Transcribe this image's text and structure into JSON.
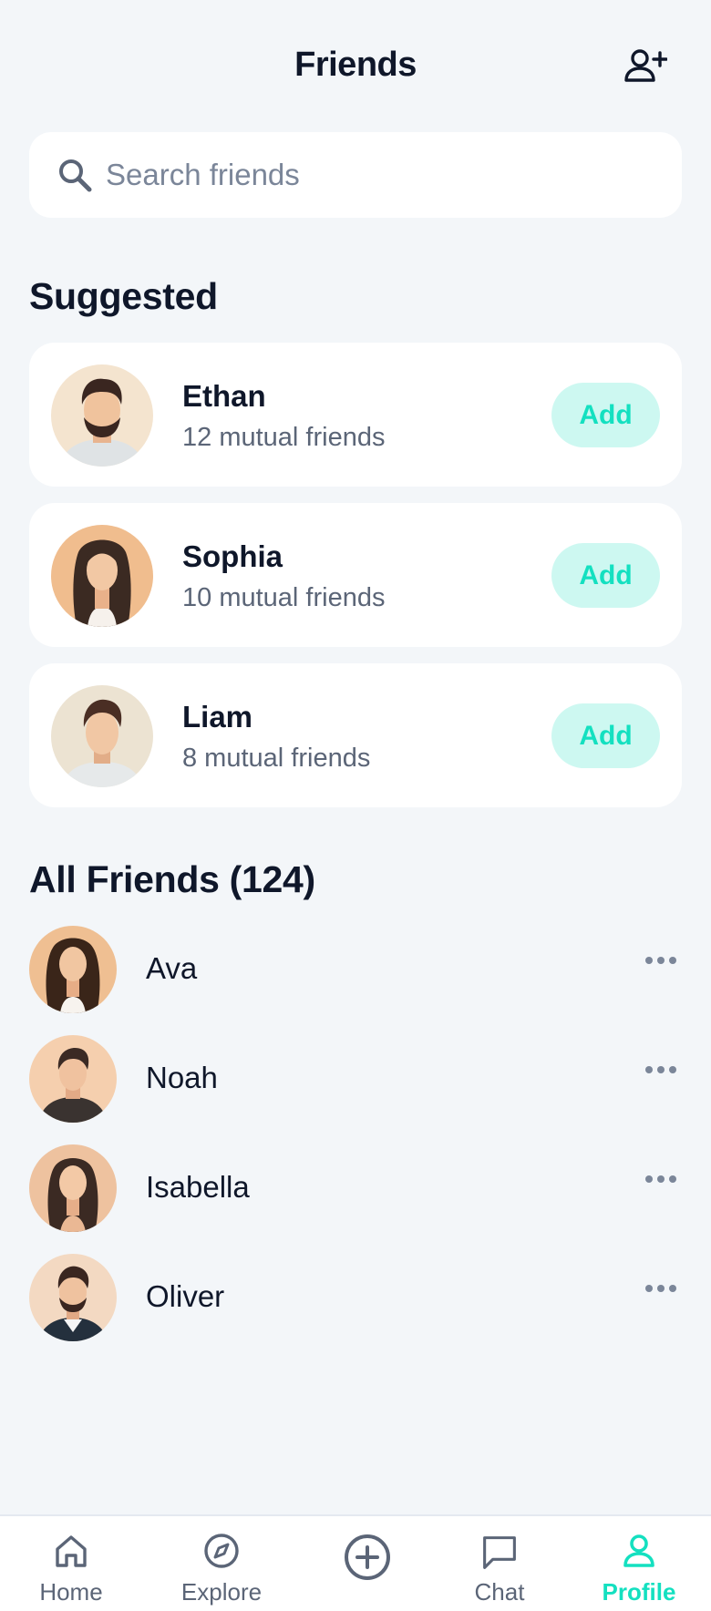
{
  "header": {
    "title": "Friends"
  },
  "search": {
    "placeholder": "Search friends",
    "value": ""
  },
  "suggested": {
    "title": "Suggested",
    "items": [
      {
        "name": "Ethan",
        "mutual": "12 mutual friends",
        "action": "Add"
      },
      {
        "name": "Sophia",
        "mutual": "10 mutual friends",
        "action": "Add"
      },
      {
        "name": "Liam",
        "mutual": "8 mutual friends",
        "action": "Add"
      }
    ]
  },
  "all_friends": {
    "title": "All Friends (124)",
    "items": [
      {
        "name": "Ava"
      },
      {
        "name": "Noah"
      },
      {
        "name": "Isabella"
      },
      {
        "name": "Oliver"
      }
    ]
  },
  "nav": {
    "items": [
      {
        "label": "Home",
        "icon": "home-icon"
      },
      {
        "label": "Explore",
        "icon": "compass-icon"
      },
      {
        "label": "",
        "icon": "plus-circle-icon"
      },
      {
        "label": "Chat",
        "icon": "chat-icon"
      },
      {
        "label": "Profile",
        "icon": "user-icon",
        "active": true
      }
    ]
  },
  "colors": {
    "accent": "#14e0c0",
    "accent_bg": "#cdf8f1",
    "background": "#f3f6f9",
    "text": "#0f172a",
    "muted": "#5b6577"
  }
}
